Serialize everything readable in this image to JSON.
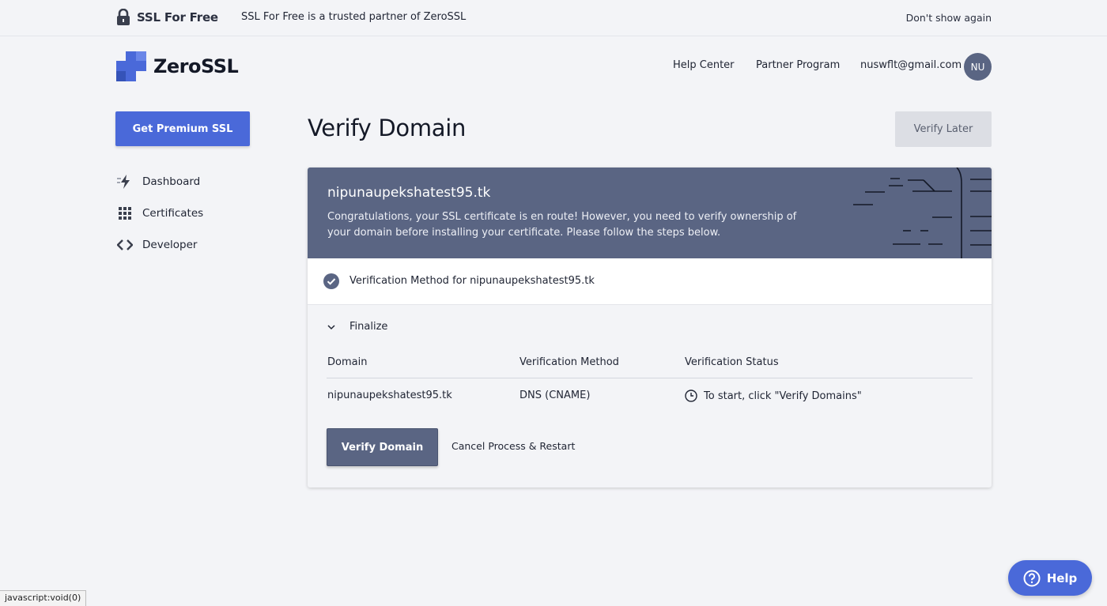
{
  "partner_bar": {
    "brand": "SSL For Free",
    "message": "SSL For Free is a trusted partner of ZeroSSL",
    "dismiss": "Don't show again"
  },
  "header": {
    "brand": "ZeroSSL",
    "nav": {
      "help_center": "Help Center",
      "partner_program": "Partner Program",
      "email": "nuswflt@gmail.com",
      "avatar_initials": "NU"
    }
  },
  "sidebar": {
    "cta": "Get Premium SSL",
    "items": [
      {
        "label": "Dashboard",
        "icon": "lightning-icon"
      },
      {
        "label": "Certificates",
        "icon": "grid-icon"
      },
      {
        "label": "Developer",
        "icon": "code-icon"
      }
    ]
  },
  "main": {
    "title": "Verify Domain",
    "verify_later": "Verify Later",
    "card": {
      "domain": "nipunaupekshatest95.tk",
      "message": "Congratulations, your SSL certificate is en route! However, you need to verify ownership of your domain before installing your certificate. Please follow the steps below.",
      "method_step": "Verification Method for nipunaupekshatest95.tk",
      "finalize_step": "Finalize",
      "table": {
        "headers": [
          "Domain",
          "Verification Method",
          "Verification Status"
        ],
        "rows": [
          {
            "domain": "nipunaupekshatest95.tk",
            "method": "DNS (CNAME)",
            "status": "To start, click \"Verify Domains\""
          }
        ]
      },
      "verify_button": "Verify Domain",
      "cancel_link": "Cancel Process & Restart"
    }
  },
  "help_widget": {
    "label": "Help"
  },
  "status_bar": {
    "url": "javascript:void(0)"
  },
  "colors": {
    "accent": "#4a69d9",
    "slate": "#5a6583",
    "background": "#f3f4f7"
  }
}
